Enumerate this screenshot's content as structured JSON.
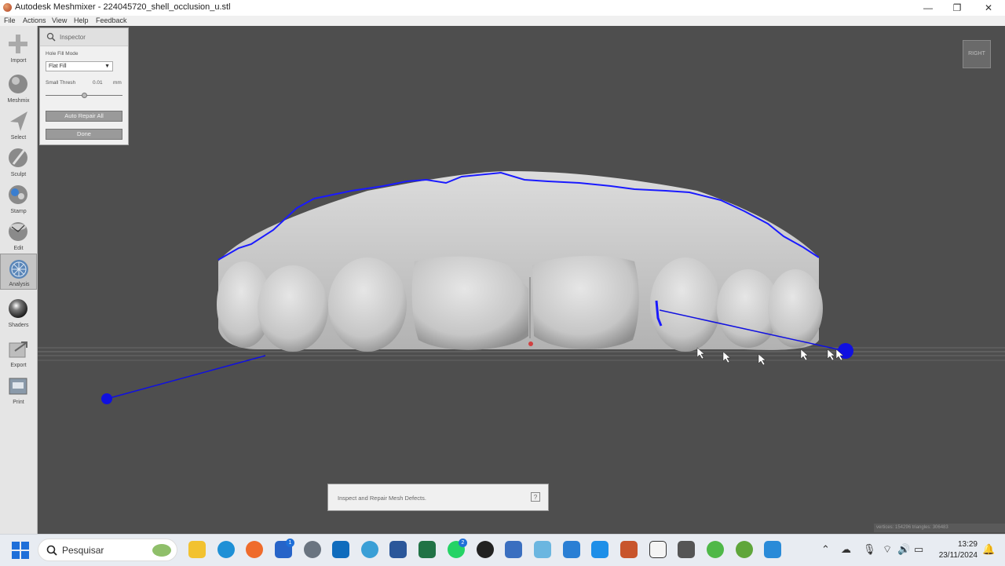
{
  "window": {
    "title": "Autodesk Meshmixer - 224045720_shell_occlusion_u.stl",
    "minimize_glyph": "—",
    "restore_glyph": "❐",
    "close_glyph": "✕"
  },
  "menu": [
    "File",
    "Actions",
    "View",
    "Help",
    "Feedback"
  ],
  "toolbar": {
    "tools": [
      {
        "label": "Import",
        "icon": "plus-icon"
      },
      {
        "label": "Meshmix",
        "icon": "meshmix-icon"
      },
      {
        "label": "Select",
        "icon": "select-arrow-icon"
      },
      {
        "label": "Sculpt",
        "icon": "sculpt-brush-icon"
      },
      {
        "label": "Stamp",
        "icon": "stamp-icon"
      },
      {
        "label": "Edit",
        "icon": "edit-icon"
      },
      {
        "label": "Analysis",
        "icon": "analysis-icon",
        "active": true
      },
      {
        "label": "Shaders",
        "icon": "shaders-sphere-icon"
      },
      {
        "label": "Export",
        "icon": "export-icon"
      },
      {
        "label": "Print",
        "icon": "print-icon"
      }
    ]
  },
  "inspector": {
    "title": "Inspector",
    "hole_fill_mode_label": "Hole Fill Mode",
    "hole_fill_mode_value": "Flat Fill",
    "small_thresh_label": "Small Thresh",
    "small_thresh_value": "0.01",
    "small_thresh_unit": "mm",
    "small_thresh_slider_fraction": 0.5,
    "auto_repair_label": "Auto Repair All",
    "done_label": "Done"
  },
  "viewport": {
    "view_cube_label": "RIGHT",
    "defect_color": "#0000ff",
    "mesh_color": "#d2d2d2"
  },
  "status": {
    "message": "Inspect and Repair Mesh Defects.",
    "help_label": "?"
  },
  "mesh_stats": "vertices: 154296 triangles: 306483",
  "taskbar": {
    "search_placeholder": "Pesquisar",
    "badges": {
      "store": "1",
      "whatsapp": "2"
    },
    "time": "13:29",
    "date": "23/11/2024"
  }
}
